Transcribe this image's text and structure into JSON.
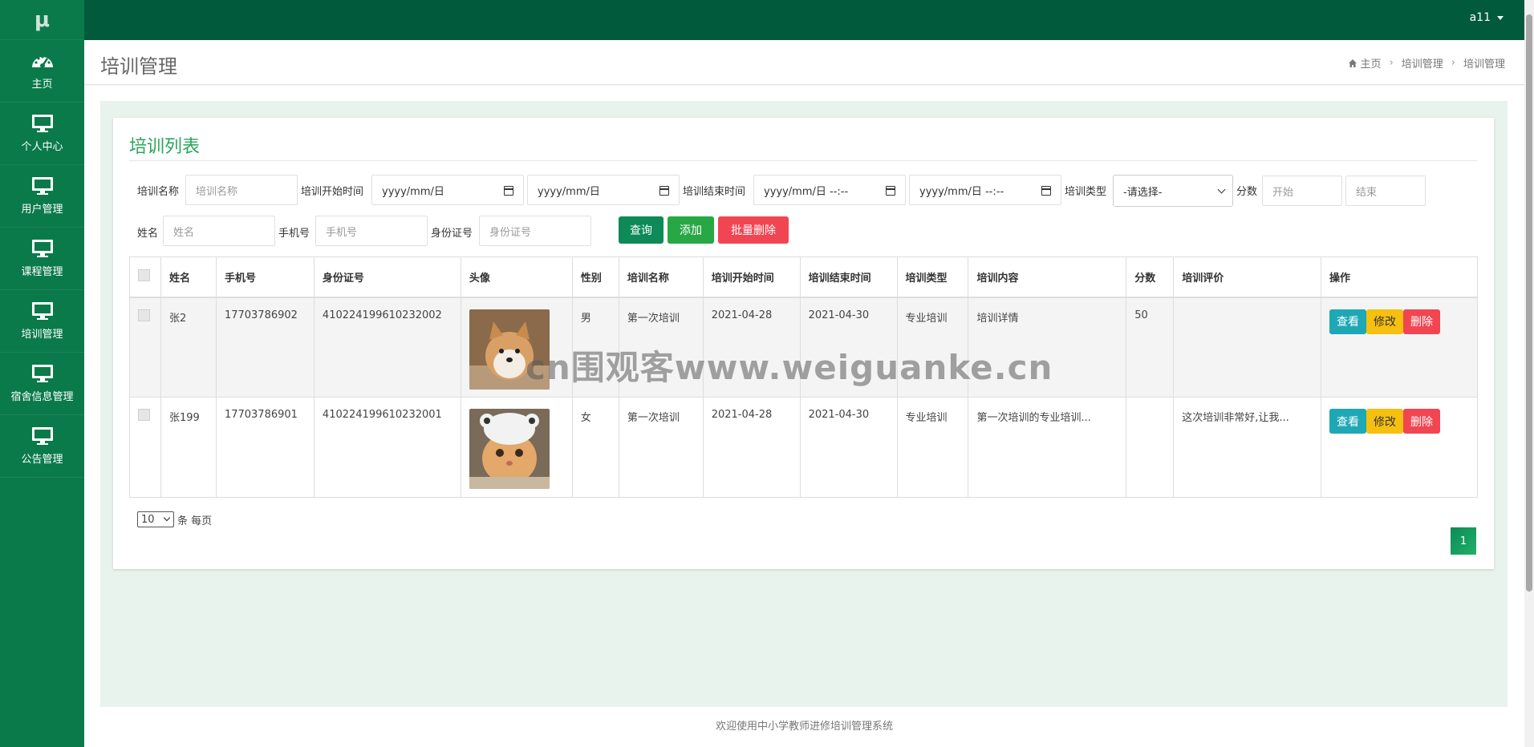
{
  "brand": {
    "logo": "μ"
  },
  "sidebar": {
    "items": [
      {
        "label": "主页",
        "icon": "dashboard-icon"
      },
      {
        "label": "个人中心",
        "icon": "monitor-icon"
      },
      {
        "label": "用户管理",
        "icon": "monitor-icon"
      },
      {
        "label": "课程管理",
        "icon": "monitor-icon"
      },
      {
        "label": "培训管理",
        "icon": "monitor-icon"
      },
      {
        "label": "宿舍信息管理",
        "icon": "monitor-icon"
      },
      {
        "label": "公告管理",
        "icon": "monitor-icon"
      }
    ]
  },
  "topbar": {
    "user": "a11"
  },
  "header": {
    "title": "培训管理",
    "breadcrumb": [
      "主页",
      "培训管理",
      "培训管理"
    ]
  },
  "panel": {
    "title": "培训列表"
  },
  "search": {
    "name_label": "培训名称",
    "name_placeholder": "培训名称",
    "start_label": "培训开始时间",
    "date_placeholder": "yyyy/mm/日",
    "end_label": "培训结束时间",
    "datetime_placeholder": "yyyy/mm/日 --:--",
    "type_label": "培训类型",
    "type_selected": "-请选择-",
    "score_label": "分数",
    "score_from_placeholder": "开始",
    "score_to_placeholder": "结束",
    "person_label": "姓名",
    "person_placeholder": "姓名",
    "phone_label": "手机号",
    "phone_placeholder": "手机号",
    "id_label": "身份证号",
    "id_placeholder": "身份证号",
    "query_btn": "查询",
    "add_btn": "添加",
    "batch_delete_btn": "批量删除"
  },
  "table": {
    "headers": [
      "姓名",
      "手机号",
      "身份证号",
      "头像",
      "性别",
      "培训名称",
      "培训开始时间",
      "培训结束时间",
      "培训类型",
      "培训内容",
      "分数",
      "培训评价",
      "操作"
    ],
    "rows": [
      {
        "name": "张2",
        "phone": "17703786902",
        "id": "410224199610232002",
        "avatar": "shiba-dog-photo",
        "gender": "男",
        "training": "第一次培训",
        "start": "2021-04-28",
        "end": "2021-04-30",
        "type": "专业培训",
        "content": "培训详情",
        "score": "50",
        "review": ""
      },
      {
        "name": "张199",
        "phone": "17703786901",
        "id": "410224199610232001",
        "avatar": "cat-photo",
        "gender": "女",
        "training": "第一次培训",
        "start": "2021-04-28",
        "end": "2021-04-30",
        "type": "专业培训",
        "content": "第一次培训的专业培训...",
        "score": "",
        "review": "这次培训非常好,让我..."
      }
    ],
    "actions": {
      "view": "查看",
      "edit": "修改",
      "delete": "删除"
    }
  },
  "pager": {
    "page_size": "10",
    "per_page_label": "条 每页",
    "current_page": "1"
  },
  "footer": {
    "text": "欢迎使用中小学教师进修培训管理系统"
  },
  "watermark": {
    "text": "cn围观客www.weiguanke.cn"
  },
  "colors": {
    "sidebar": "#0a7a4a",
    "topbar": "#005a3b",
    "accent": "#2aa65b",
    "danger": "#f14652",
    "info": "#1ea7b5",
    "warning": "#f5c00f"
  }
}
